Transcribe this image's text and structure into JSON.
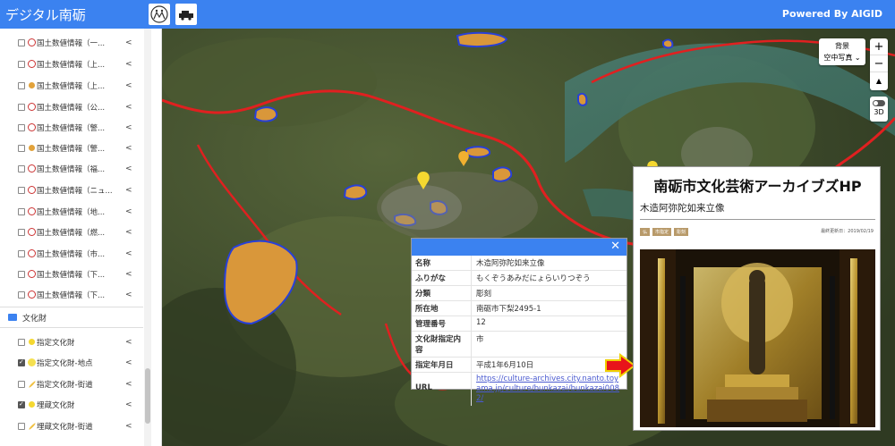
{
  "header": {
    "app_title": "デジタル南砺",
    "powered_by": "Powered By AIGID",
    "logo_icons": [
      "people-logo-icon",
      "vehicle-logo-icon"
    ]
  },
  "sidebar": {
    "layers": [
      {
        "label": "国土数値情報（一...",
        "checked": false,
        "icon": "red-circle-icon"
      },
      {
        "label": "国土数値情報（上...",
        "checked": false,
        "icon": "red-circle-icon"
      },
      {
        "label": "国土数値情報（上...",
        "checked": false,
        "icon": "orange-dot-icon"
      },
      {
        "label": "国土数値情報（公...",
        "checked": false,
        "icon": "red-circle-icon"
      },
      {
        "label": "国土数値情報（警...",
        "checked": false,
        "icon": "red-circle-icon"
      },
      {
        "label": "国土数値情報（警...",
        "checked": false,
        "icon": "orange-dot-icon"
      },
      {
        "label": "国土数値情報（福...",
        "checked": false,
        "icon": "red-circle-icon"
      },
      {
        "label": "国土数値情報（ニュ...",
        "checked": false,
        "icon": "red-circle-icon"
      },
      {
        "label": "国土数値情報（地...",
        "checked": false,
        "icon": "red-circle-icon"
      },
      {
        "label": "国土数値情報（燃...",
        "checked": false,
        "icon": "red-circle-icon"
      },
      {
        "label": "国土数値情報（市...",
        "checked": false,
        "icon": "red-circle-icon"
      },
      {
        "label": "国土数値情報（下...",
        "checked": false,
        "icon": "red-circle-icon"
      },
      {
        "label": "国土数値情報（下...",
        "checked": false,
        "icon": "red-circle-icon"
      }
    ],
    "folder_label": "文化財",
    "culture_layers": [
      {
        "label": "指定文化財",
        "checked": false,
        "icon": "yellow-dot-icon"
      },
      {
        "label": "指定文化財-地点",
        "checked": true,
        "icon": "yellow-circle-icon"
      },
      {
        "label": "指定文化財-街道",
        "checked": false,
        "icon": "yellow-line-icon"
      },
      {
        "label": "埋蔵文化財",
        "checked": true,
        "icon": "yellow-dot-icon"
      },
      {
        "label": "埋蔵文化財-街道",
        "checked": false,
        "icon": "yellow-line-icon"
      }
    ],
    "share_glyph": "<"
  },
  "map_controls": {
    "background_title": "背景",
    "background_value": "空中写真",
    "zoom_in": "+",
    "zoom_out": "−",
    "mode_3d": "3D"
  },
  "popup": {
    "rows": [
      {
        "key": "名称",
        "value": "木造阿弥陀如来立像"
      },
      {
        "key": "ふりがな",
        "value": "もくぞうあみだにょらいりつぞう"
      },
      {
        "key": "分類",
        "value": "彫刻"
      },
      {
        "key": "所在地",
        "value": "南砺市下梨2495-1"
      },
      {
        "key": "管理番号",
        "value": "12"
      },
      {
        "key": "文化財指定内容",
        "value": "市"
      },
      {
        "key": "指定年月日",
        "value": "平成1年6月10日"
      }
    ],
    "url_key": "URL",
    "url_value": "https://culture-archives.city.nanto.toyama.jp/culture/bunkazai/bunkazai0082/"
  },
  "archive_page": {
    "title": "南砺市文化芸術アーカイブズHP",
    "subtitle": "木造阿弥陀如来立像",
    "tags": [
      "仏",
      "市指定",
      "彫刻"
    ],
    "updated": "最終更新日：2019/02/19"
  },
  "colors": {
    "header_blue": "#3b82f0",
    "road_red": "#e02020",
    "area_orange": "#d9973a",
    "area_border_blue": "#2840d8",
    "arrow_red": "#e8141a",
    "arrow_yellow": "#f0d000"
  }
}
